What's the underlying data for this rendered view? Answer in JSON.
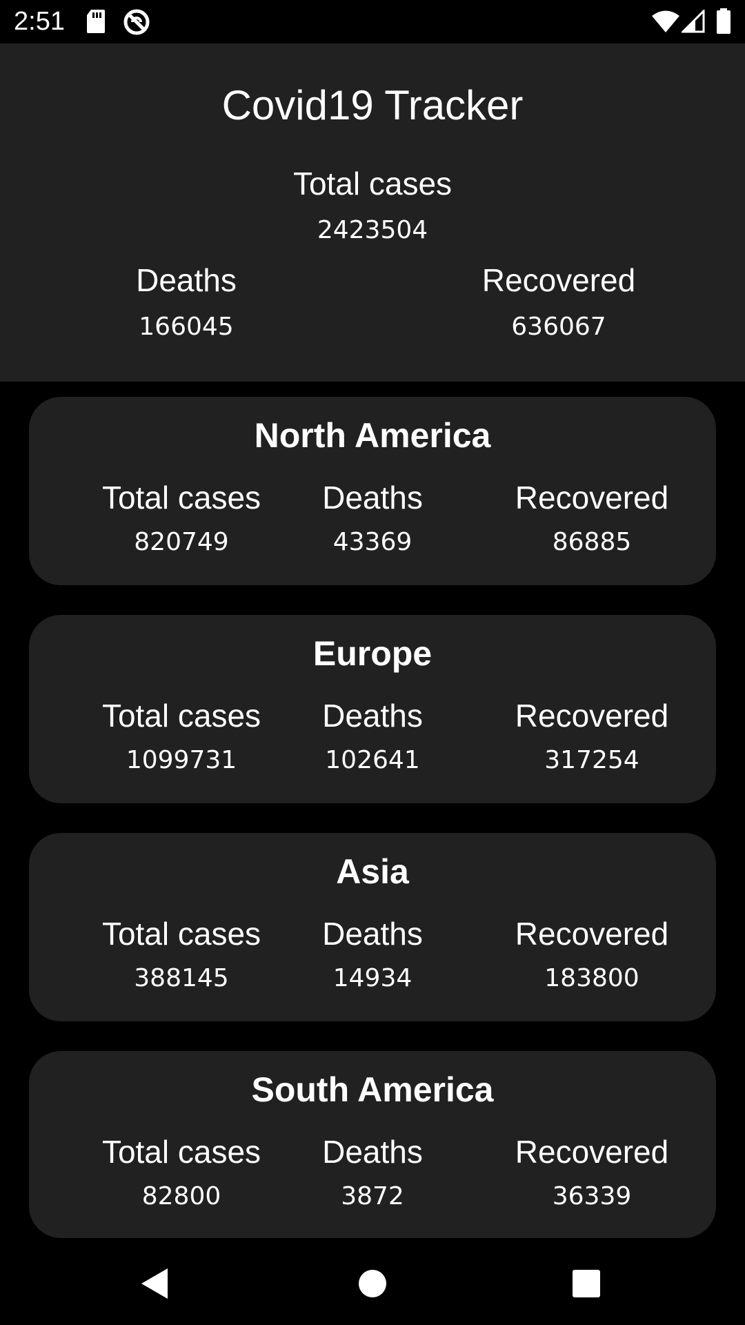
{
  "status_bar": {
    "time": "2:51",
    "left_icons": [
      "sd-card-icon",
      "no-disturb-icon"
    ],
    "right_icons": [
      "wifi-icon",
      "signal-icon",
      "battery-icon"
    ]
  },
  "header": {
    "title": "Covid19 Tracker",
    "total": {
      "label": "Total cases",
      "value": "2423504"
    },
    "deaths": {
      "label": "Deaths",
      "value": "166045"
    },
    "recovered": {
      "label": "Recovered",
      "value": "636067"
    }
  },
  "continents": [
    {
      "name": "North America",
      "stats": [
        {
          "label": "Total cases",
          "value": "820749"
        },
        {
          "label": "Deaths",
          "value": "43369"
        },
        {
          "label": "Recovered",
          "value": "86885"
        }
      ]
    },
    {
      "name": "Europe",
      "stats": [
        {
          "label": "Total cases",
          "value": "1099731"
        },
        {
          "label": "Deaths",
          "value": "102641"
        },
        {
          "label": "Recovered",
          "value": "317254"
        }
      ]
    },
    {
      "name": "Asia",
      "stats": [
        {
          "label": "Total cases",
          "value": "388145"
        },
        {
          "label": "Deaths",
          "value": "14934"
        },
        {
          "label": "Recovered",
          "value": "183800"
        }
      ]
    },
    {
      "name": "South America",
      "stats": [
        {
          "label": "Total cases",
          "value": "82800"
        },
        {
          "label": "Deaths",
          "value": "3872"
        },
        {
          "label": "Recovered",
          "value": "36339"
        }
      ]
    }
  ],
  "nav_bar": {
    "buttons": [
      "back-icon",
      "home-icon",
      "recents-icon"
    ]
  },
  "colors": {
    "background": "#000000",
    "panel": "#212121",
    "text": "#ffffff"
  }
}
